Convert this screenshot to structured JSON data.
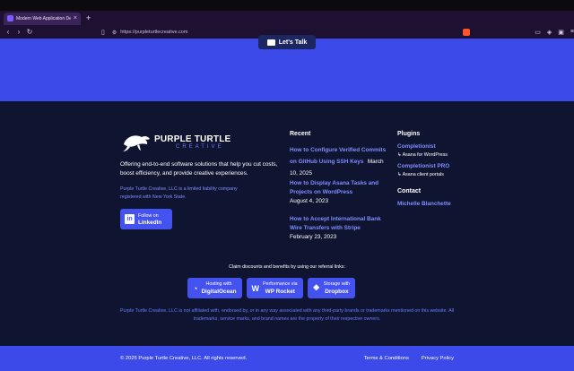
{
  "browser": {
    "tab_title": "Modern Web Application Dev",
    "url": "https://purpleturtlecreative.com"
  },
  "hero": {
    "cta_label": "Let's Talk"
  },
  "brand": {
    "name": "PURPLE TURTLE",
    "sub": "CREATIVE",
    "tagline": "Offering end-to-end software solutions that help you cut costs, boost efficiency, and provide creative experiences.",
    "legal_note": "Purple Turtle Creative, LLC is a limited liability company registered with New York State.",
    "linkedin_line1": "Follow on",
    "linkedin_line2": "LinkedIn"
  },
  "recent": {
    "heading": "Recent",
    "posts": [
      {
        "title": "How to Configure Verified Commits on GitHub Using SSH Keys",
        "date": "March 10, 2025"
      },
      {
        "title": "How to Display Asana Tasks and Projects on WordPress",
        "date": "August 4, 2023"
      },
      {
        "title": "How to Accept International Bank Wire Transfers with Stripe",
        "date": "February 23, 2023"
      }
    ]
  },
  "plugins": {
    "heading": "Plugins",
    "items": [
      {
        "name": "Completionist",
        "desc": "Asana for WordPress"
      },
      {
        "name": "Completionist PRO",
        "desc": "Asana client portals"
      }
    ]
  },
  "contact": {
    "heading": "Contact",
    "name": "Michelle Blanchette"
  },
  "referral": {
    "heading": "Claim discounts and benefits by using our referral links:",
    "buttons": [
      {
        "line1": "Hosting with",
        "line2": "DigitalOcean",
        "icon": "digitalocean-icon"
      },
      {
        "line1": "Performance via",
        "line2": "WP Rocket",
        "icon": "wp-rocket-icon"
      },
      {
        "line1": "Storage with",
        "line2": "Dropbox",
        "icon": "dropbox-icon"
      }
    ],
    "disclaimer": "Purple Turtle Creative, LLC is not affiliated with, endorsed by, or in any way associated with any third-party brands or trademarks mentioned on this website. All trademarks, service marks, and brand names are the property of their respective owners."
  },
  "bottom": {
    "copyright": "© 2025 Purple Turtle Creative, LLC. All rights reserved.",
    "terms": "Terms & Conditions",
    "privacy": "Privacy Policy"
  }
}
